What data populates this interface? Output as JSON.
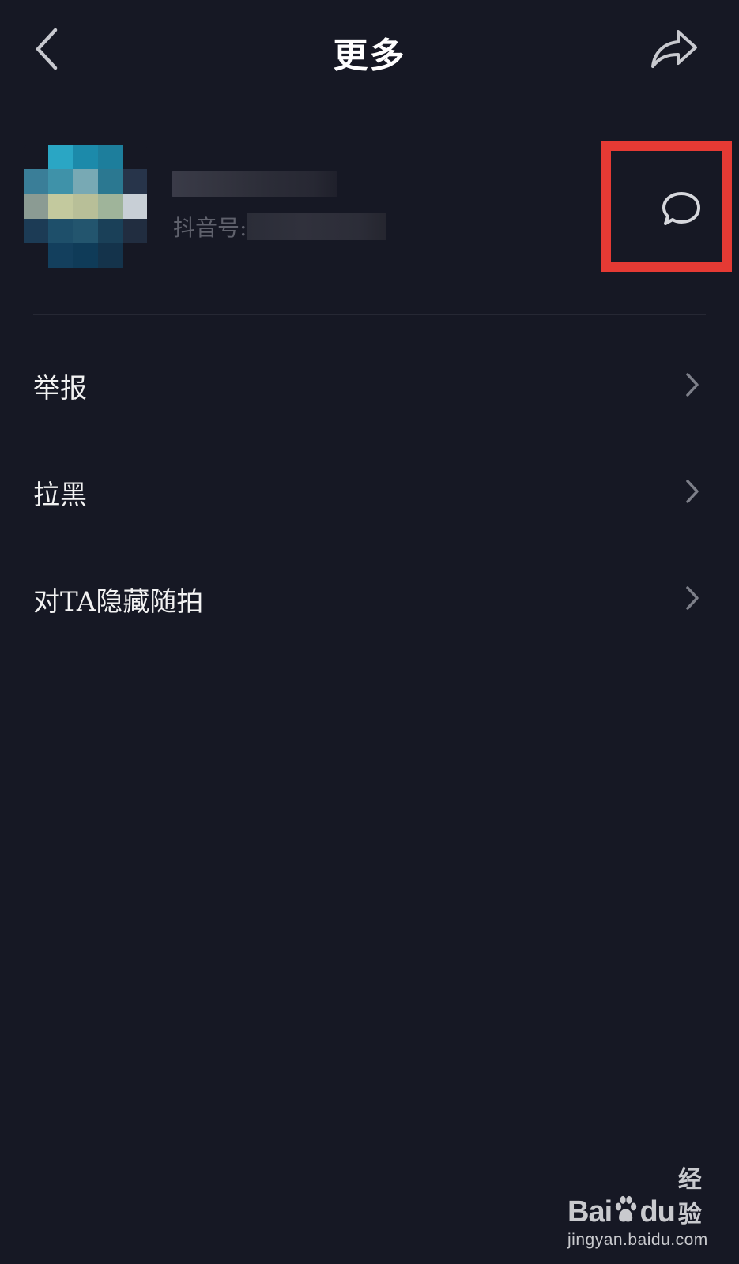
{
  "navbar": {
    "title": "更多",
    "back_icon": "chevron-left-icon",
    "share_icon": "share-arrow-icon"
  },
  "profile": {
    "name": "",
    "id_label": "抖音号:",
    "id_value": "",
    "message_icon": "message-bubble-icon",
    "highlight_color": "#e53a34"
  },
  "menu": {
    "items": [
      {
        "label": "举报"
      },
      {
        "label": "拉黑"
      },
      {
        "label": "对TA隐藏随拍"
      }
    ]
  },
  "watermark": {
    "brand_left": "Bai",
    "brand_du": "du",
    "brand_right": "经验",
    "url": "jingyan.baidu.com"
  },
  "colors": {
    "background": "#161824",
    "text": "#f2f2f2",
    "muted": "#5f616c",
    "chevron": "#7d7f89"
  }
}
